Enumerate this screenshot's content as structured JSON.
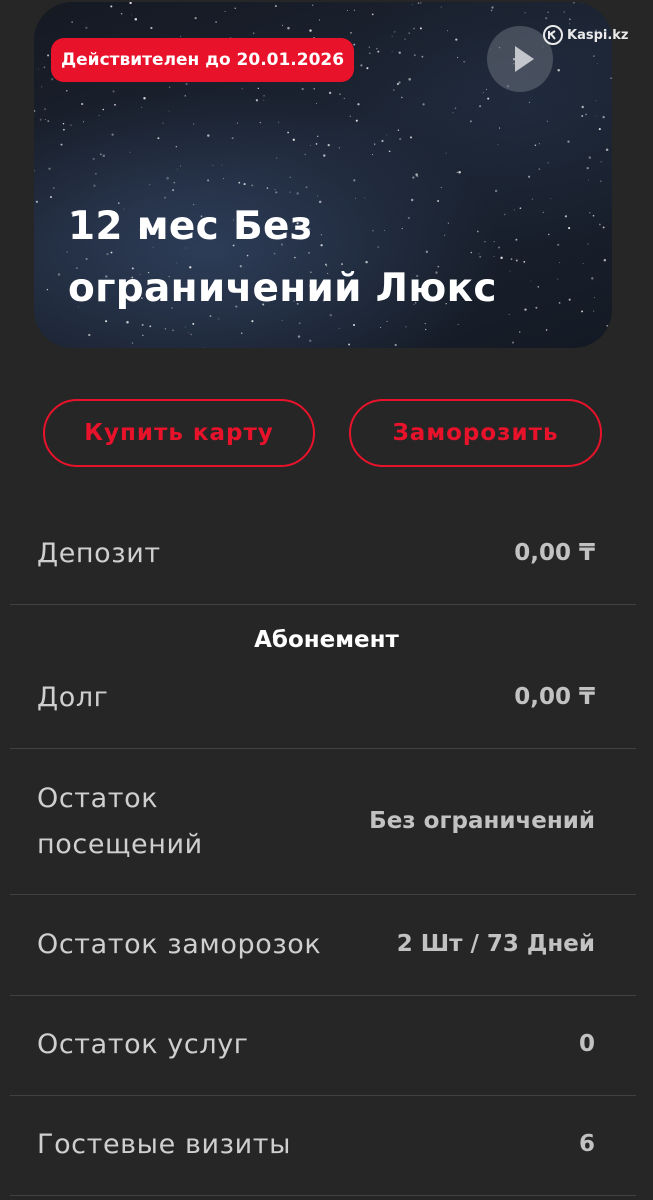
{
  "card": {
    "badge": "Действителен до 20.01.2026",
    "title": "12 мес Без ограничений Люкс",
    "watermark": "Kaspi.kz"
  },
  "actions": {
    "buy_label": "Купить карту",
    "freeze_label": "Заморозить"
  },
  "deposit": {
    "label": "Депозит",
    "value": "0,00 ₸"
  },
  "subscription": {
    "section_title": "Абонемент",
    "rows": [
      {
        "label": "Долг",
        "value": "0,00 ₸"
      },
      {
        "label": "Остаток посещений",
        "value": "Без ограничений"
      },
      {
        "label": "Остаток заморозок",
        "value": "2 Шт / 73 Дней"
      },
      {
        "label": "Остаток услуг",
        "value": "0"
      },
      {
        "label": "Гостевые визиты",
        "value": "6"
      }
    ]
  },
  "colors": {
    "accent": "#e8132b",
    "background": "#262626",
    "divider": "#414141"
  }
}
